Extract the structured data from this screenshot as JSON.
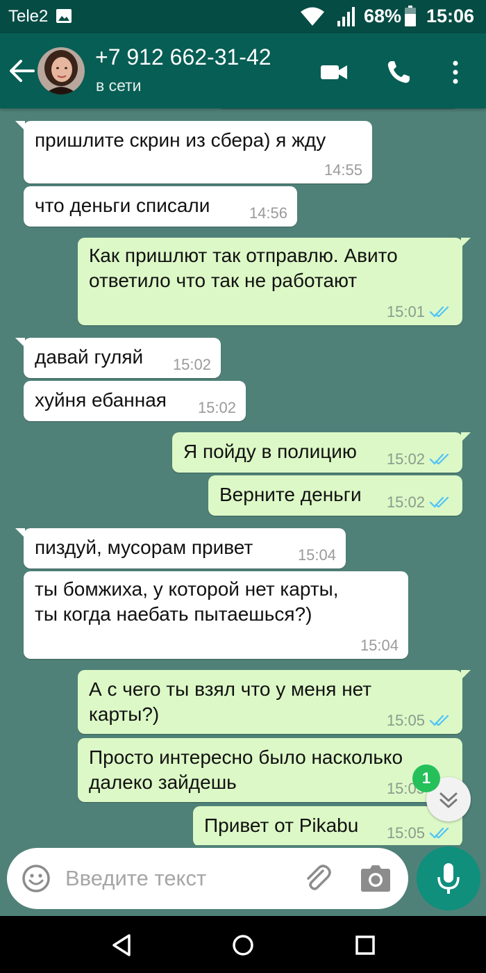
{
  "status_bar": {
    "carrier": "Tele2",
    "battery": "68%",
    "time": "15:06",
    "icons": [
      "gallery-icon",
      "wifi-icon",
      "signal-icon",
      "battery-icon"
    ]
  },
  "header": {
    "contact": "+7 912 662-31-42",
    "status": "в сети",
    "icons": [
      "back-arrow-icon",
      "video-call-icon",
      "phone-icon",
      "more-vert-icon"
    ]
  },
  "messages": [
    {
      "dir": "in",
      "lines": [
        "пришлите скрин из сбера) я жду"
      ],
      "time": "14:55"
    },
    {
      "dir": "in",
      "lines": [
        "что деньги списали"
      ],
      "time": "14:56"
    },
    {
      "dir": "out",
      "lines": [
        "Как пришлют так отправлю. Авито",
        "ответило что так не работают"
      ],
      "time": "15:01"
    },
    {
      "dir": "in",
      "lines": [
        "давай гуляй"
      ],
      "time": "15:02"
    },
    {
      "dir": "in",
      "lines": [
        "хуйня ебанная"
      ],
      "time": "15:02"
    },
    {
      "dir": "out",
      "lines": [
        "Я пойду в полицию"
      ],
      "time": "15:02"
    },
    {
      "dir": "out",
      "lines": [
        "Верните деньги"
      ],
      "time": "15:02"
    },
    {
      "dir": "in",
      "lines": [
        "пиздуй, мусорам привет"
      ],
      "time": "15:04"
    },
    {
      "dir": "in",
      "lines": [
        "ты бомжиха, у которой нет карты,",
        "ты когда наебать пытаешься?)"
      ],
      "time": "15:04"
    },
    {
      "dir": "out",
      "lines": [
        "А с чего ты взял что у меня нет",
        "карты?)"
      ],
      "time": "15:05"
    },
    {
      "dir": "out",
      "lines": [
        "Просто интересно было насколько",
        "далеко зайдешь"
      ],
      "time": "15:05"
    },
    {
      "dir": "out",
      "lines": [
        "Привет от Pikabu"
      ],
      "time": "15:05"
    }
  ],
  "unread_count": "1",
  "composer": {
    "placeholder": "Введите текст"
  },
  "colors": {
    "header": "#075e54",
    "status_bar": "#054c44",
    "outgoing_bubble": "#dcf8c6",
    "incoming_bubble": "#ffffff",
    "wallpaper": "#4f8178",
    "read_ticks": "#4fc3f7",
    "mic_button": "#0f8f7c",
    "unread_badge": "#25c05a"
  }
}
